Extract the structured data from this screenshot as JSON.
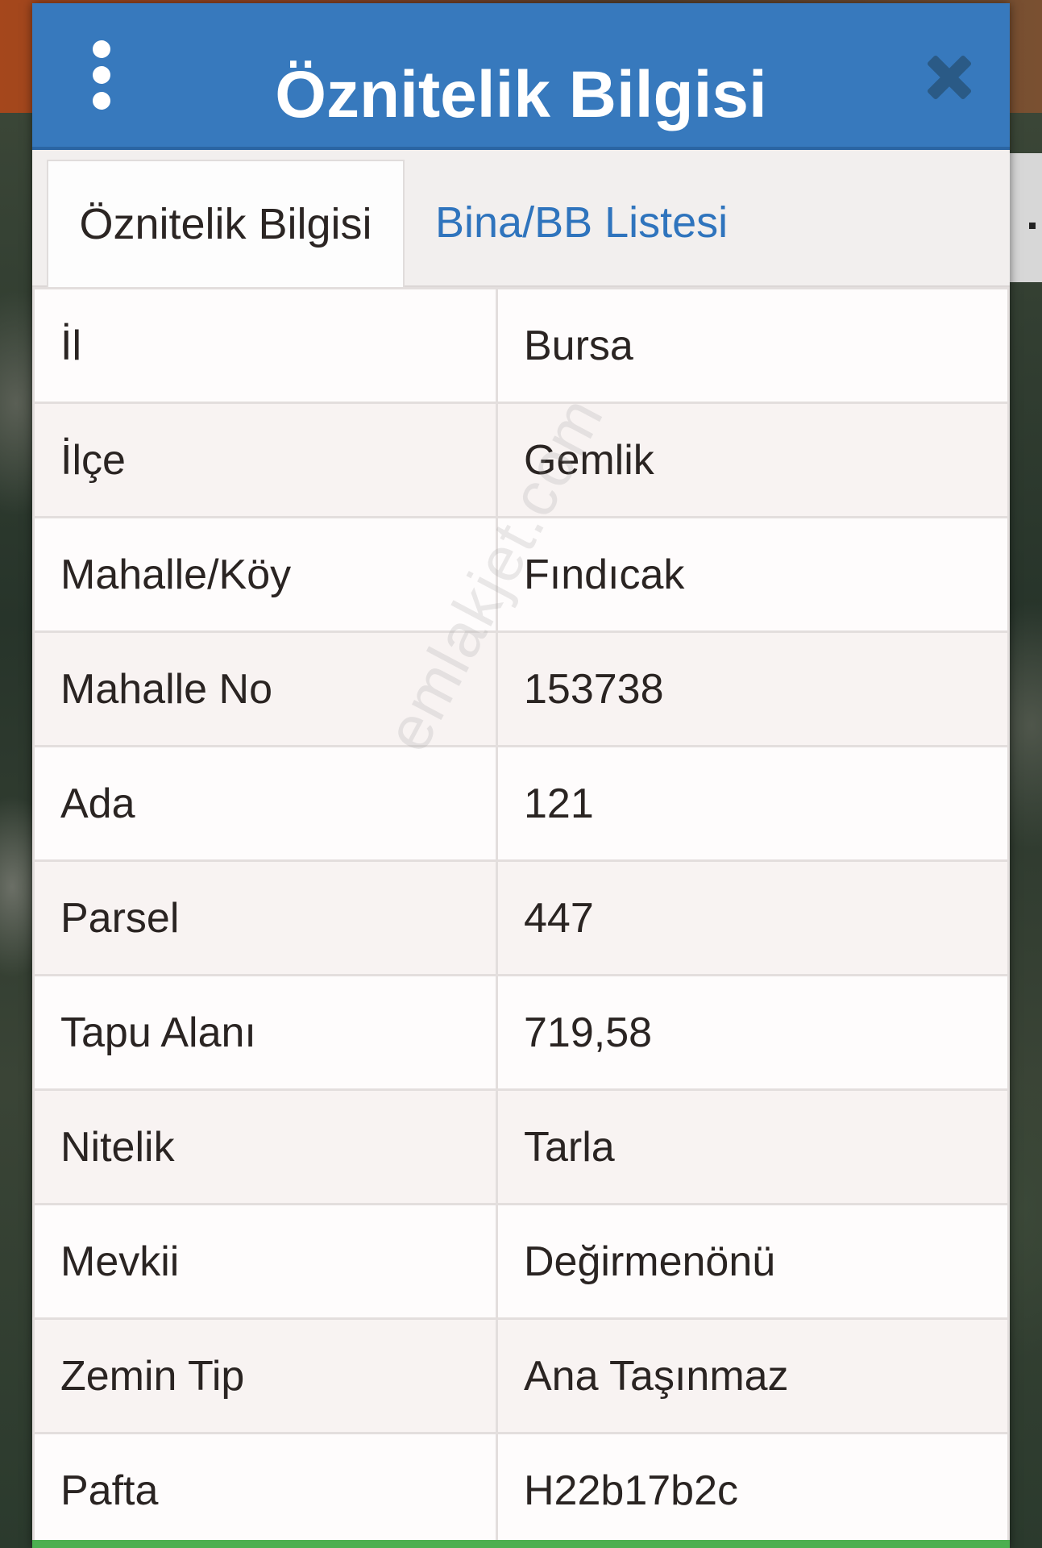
{
  "dialog": {
    "title": "Öznitelik Bilgisi",
    "menu_icon": "vertical-ellipsis-icon",
    "close_icon": "close-icon",
    "header_color": "#3779bd"
  },
  "tabs": [
    {
      "label": "Öznitelik Bilgisi",
      "active": true
    },
    {
      "label": "Bina/BB Listesi",
      "active": false
    }
  ],
  "attributes": [
    {
      "key": "İl",
      "value": "Bursa"
    },
    {
      "key": "İlçe",
      "value": "Gemlik"
    },
    {
      "key": "Mahalle/Köy",
      "value": "Fındıcak"
    },
    {
      "key": "Mahalle No",
      "value": "153738"
    },
    {
      "key": "Ada",
      "value": "121"
    },
    {
      "key": "Parsel",
      "value": "447"
    },
    {
      "key": "Tapu Alanı",
      "value": "719,58"
    },
    {
      "key": "Nitelik",
      "value": "Tarla"
    },
    {
      "key": "Mevkii",
      "value": "Değirmenönü"
    },
    {
      "key": "Zemin Tip",
      "value": "Ana Taşınmaz"
    },
    {
      "key": "Pafta",
      "value": "H22b17b2c"
    }
  ],
  "watermark": "emlakjet.com"
}
